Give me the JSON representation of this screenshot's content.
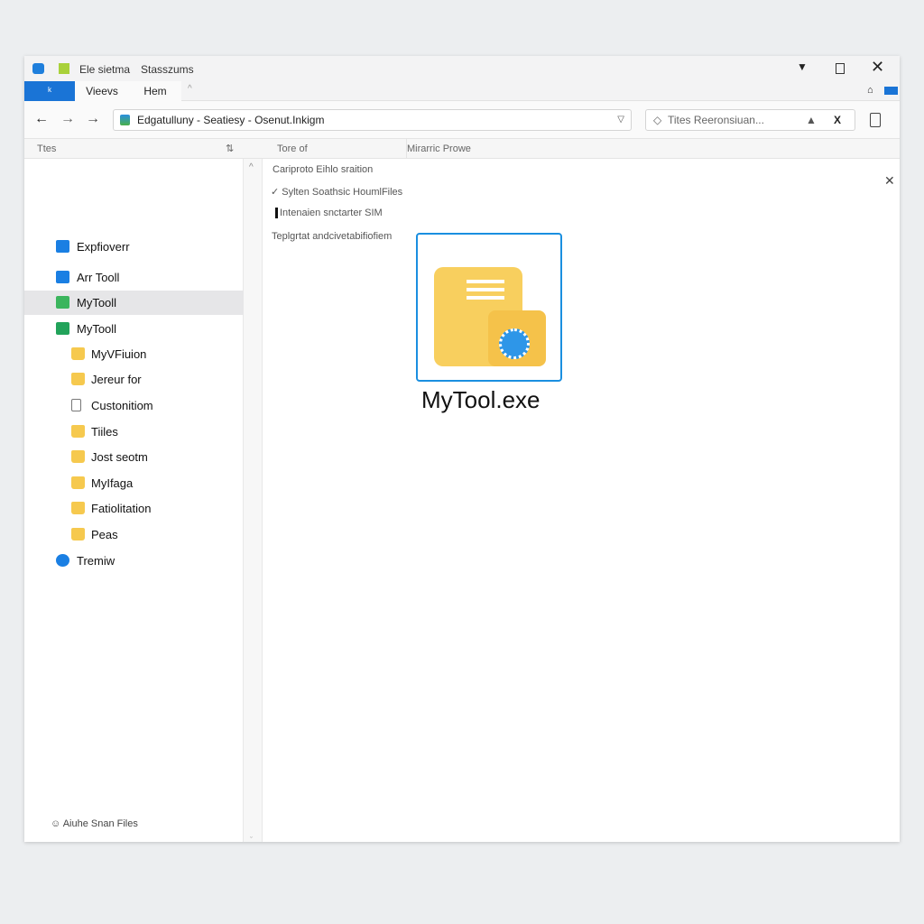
{
  "window": {
    "title": "Ele sietma",
    "title2": "Stasszums"
  },
  "ribbon": {
    "tabs": [
      "Vieevs",
      "Hem"
    ],
    "active_tab_icon": "file-tab-icon"
  },
  "address": {
    "path": "Edgatulluny  -  Seatiesy  -  Osenut.Inkigm",
    "search_placeholder": "Tites Reeronsiuan..."
  },
  "columns": {
    "name": "Ttes",
    "type": "Tore of",
    "modified": "Mirarric Prowe"
  },
  "sidebar": {
    "items": [
      {
        "label": "Expfioverr",
        "icon": "blue-square-icon"
      },
      {
        "label": "Arr Tooll",
        "icon": "blue-cloud-icon"
      },
      {
        "label": "MyTooll",
        "icon": "green-network-icon",
        "selected": true
      },
      {
        "label": "MyTooll",
        "icon": "green-house-icon"
      },
      {
        "label": "MyVFiuion",
        "icon": "folder-icon"
      },
      {
        "label": "Jereur for",
        "icon": "folder-icon"
      },
      {
        "label": "Custonitiom",
        "icon": "document-icon"
      },
      {
        "label": "Tiiles",
        "icon": "folder-icon"
      },
      {
        "label": "Jost seotm",
        "icon": "folder-icon"
      },
      {
        "label": "MyIfaga",
        "icon": "folder-icon"
      },
      {
        "label": "Fatiolitation",
        "icon": "folder-icon"
      },
      {
        "label": "Peas",
        "icon": "folder-icon"
      },
      {
        "label": "Tremiw",
        "icon": "blue-badge-icon"
      }
    ],
    "footer": "Aiuhe Snan Files"
  },
  "content": {
    "lines": [
      "Cariproto Eihlo sraition",
      "Sylten Soathsic HoumlFiles",
      "Intenaien snctarter SIM",
      "Teplgrtat andcivetabifiofiem"
    ],
    "file_label": "MyTool.exe"
  }
}
